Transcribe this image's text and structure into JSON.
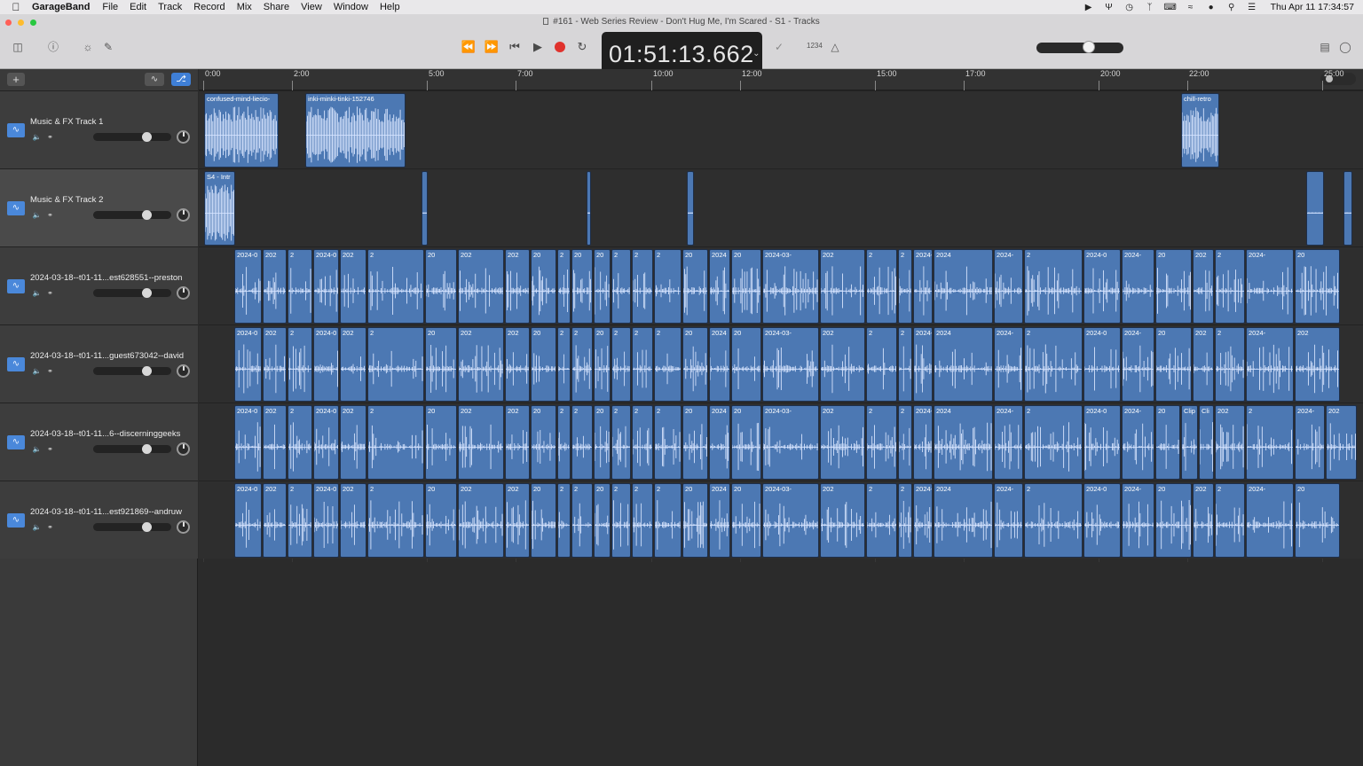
{
  "menubar": {
    "app_name": "GarageBand",
    "items": [
      "File",
      "Edit",
      "Track",
      "Record",
      "Mix",
      "Share",
      "View",
      "Window",
      "Help"
    ],
    "status_icons": [
      "play-circle-icon",
      "antenna-icon",
      "history-icon",
      "bluetooth-icon",
      "keyboard-icon",
      "wifi-icon",
      "user-icon",
      "search-icon",
      "control-center-icon"
    ],
    "clock": "Thu Apr 11  17:34:57"
  },
  "window": {
    "title": "#161 - Web Series Review - Don't Hug Me, I'm Scared - S1 - Tracks",
    "lcd_time": "01:51:13.662",
    "count_in": "1234",
    "master_volume": 0.62,
    "colors": {
      "region": "#4c78b3",
      "record": "#e0322d",
      "accent": "#3f7fd6"
    }
  },
  "ruler": {
    "labels": [
      "0:00",
      "2:00",
      "5:00",
      "7:00",
      "10:00",
      "12:00",
      "15:00",
      "17:00",
      "20:00",
      "22:00",
      "25:00"
    ]
  },
  "tracks": [
    {
      "name": "Music & FX Track 1",
      "volume": 0.72,
      "selected": false
    },
    {
      "name": "Music & FX Track 2",
      "volume": 0.72,
      "selected": true
    },
    {
      "name": "2024-03-18--t01-11...est628551--preston",
      "volume": 0.72,
      "selected": false
    },
    {
      "name": "2024-03-18--t01-11...guest673042--david",
      "volume": 0.72,
      "selected": false
    },
    {
      "name": "2024-03-18--t01-11...6--discerninggeeks",
      "volume": 0.72,
      "selected": false
    },
    {
      "name": "2024-03-18--t01-11...est921869--andruw",
      "volume": 0.72,
      "selected": false
    }
  ],
  "regions": [
    [
      {
        "label": "confused-mind-liecio-",
        "wave": "dense"
      },
      {
        "label": "inki-minki-tinki-152746",
        "wave": "dense"
      },
      {
        "label": "chill-retro",
        "wave": "dense"
      }
    ],
    [
      {
        "label": "S4 - Intr",
        "wave": "dense"
      },
      {
        "label": "",
        "wave": "flat"
      },
      {
        "label": "",
        "wave": "flat"
      },
      {
        "label": "",
        "wave": "flat"
      },
      {
        "label": "",
        "wave": "flat"
      },
      {
        "label": "",
        "wave": "flat"
      }
    ],
    [
      {
        "label": "2024-0"
      },
      {
        "label": "202"
      },
      {
        "label": "2"
      },
      {
        "label": "2024-0"
      },
      {
        "label": "202"
      },
      {
        "label": "2"
      },
      {
        "label": "20"
      },
      {
        "label": "202"
      },
      {
        "label": "202"
      },
      {
        "label": "20"
      },
      {
        "label": "2"
      },
      {
        "label": "20"
      },
      {
        "label": "20"
      },
      {
        "label": "2"
      },
      {
        "label": "2"
      },
      {
        "label": "2"
      },
      {
        "label": "20"
      },
      {
        "label": "2024"
      },
      {
        "label": "20"
      },
      {
        "label": "2024-03-"
      },
      {
        "label": "202"
      },
      {
        "label": "2"
      },
      {
        "label": "2"
      },
      {
        "label": "2024-03-18--t01"
      },
      {
        "label": "2024"
      },
      {
        "label": "2024-"
      },
      {
        "label": "2"
      },
      {
        "label": "2024-0"
      },
      {
        "label": "2024-"
      },
      {
        "label": "20"
      },
      {
        "label": "202"
      },
      {
        "label": "2"
      },
      {
        "label": "2024-"
      },
      {
        "label": "20"
      }
    ],
    [
      {
        "label": "2024-0"
      },
      {
        "label": "202"
      },
      {
        "label": "2"
      },
      {
        "label": "2024-0"
      },
      {
        "label": "202"
      },
      {
        "label": "2"
      },
      {
        "label": "20"
      },
      {
        "label": "202"
      },
      {
        "label": "202"
      },
      {
        "label": "20"
      },
      {
        "label": "2"
      },
      {
        "label": "2"
      },
      {
        "label": "20"
      },
      {
        "label": "2"
      },
      {
        "label": "2"
      },
      {
        "label": "2"
      },
      {
        "label": "20"
      },
      {
        "label": "2024"
      },
      {
        "label": "20"
      },
      {
        "label": "2024-03-"
      },
      {
        "label": "202"
      },
      {
        "label": "2"
      },
      {
        "label": "2"
      },
      {
        "label": "2024-03-18--t01"
      },
      {
        "label": "2024"
      },
      {
        "label": "2024-"
      },
      {
        "label": "2"
      },
      {
        "label": "2024-0"
      },
      {
        "label": "2024-"
      },
      {
        "label": "20"
      },
      {
        "label": "202"
      },
      {
        "label": "2"
      },
      {
        "label": "2024-"
      },
      {
        "label": "202"
      }
    ],
    [
      {
        "label": "2024-0"
      },
      {
        "label": "202"
      },
      {
        "label": "2"
      },
      {
        "label": "2024-0"
      },
      {
        "label": "202"
      },
      {
        "label": "2"
      },
      {
        "label": "20"
      },
      {
        "label": "202"
      },
      {
        "label": "202"
      },
      {
        "label": "20"
      },
      {
        "label": "2"
      },
      {
        "label": "2"
      },
      {
        "label": "20"
      },
      {
        "label": "2"
      },
      {
        "label": "2"
      },
      {
        "label": "2"
      },
      {
        "label": "20"
      },
      {
        "label": "2024"
      },
      {
        "label": "20"
      },
      {
        "label": "2024-03-"
      },
      {
        "label": "202"
      },
      {
        "label": "2"
      },
      {
        "label": "2"
      },
      {
        "label": "2024-03-18--t01"
      },
      {
        "label": "2024"
      },
      {
        "label": "2024-"
      },
      {
        "label": "2"
      },
      {
        "label": "2024-0"
      },
      {
        "label": "2024-"
      },
      {
        "label": "20"
      },
      {
        "label": "Clip"
      },
      {
        "label": "Cli"
      },
      {
        "label": "202"
      },
      {
        "label": "2"
      },
      {
        "label": "2024-"
      },
      {
        "label": "202"
      }
    ],
    [
      {
        "label": "2024-0"
      },
      {
        "label": "202"
      },
      {
        "label": "2"
      },
      {
        "label": "2024-0"
      },
      {
        "label": "202"
      },
      {
        "label": "2"
      },
      {
        "label": "20"
      },
      {
        "label": "202"
      },
      {
        "label": "202"
      },
      {
        "label": "20"
      },
      {
        "label": "2"
      },
      {
        "label": "2"
      },
      {
        "label": "20"
      },
      {
        "label": "2"
      },
      {
        "label": "2"
      },
      {
        "label": "2"
      },
      {
        "label": "20"
      },
      {
        "label": "2024"
      },
      {
        "label": "20"
      },
      {
        "label": "2024-03-"
      },
      {
        "label": "202"
      },
      {
        "label": "2"
      },
      {
        "label": "2"
      },
      {
        "label": "2024-03-18--t01"
      },
      {
        "label": "2024"
      },
      {
        "label": "2024-"
      },
      {
        "label": "2"
      },
      {
        "label": "2024-0"
      },
      {
        "label": "2024-"
      },
      {
        "label": "20"
      },
      {
        "label": "202"
      },
      {
        "label": "2"
      },
      {
        "label": "2024-"
      },
      {
        "label": "20"
      }
    ]
  ]
}
